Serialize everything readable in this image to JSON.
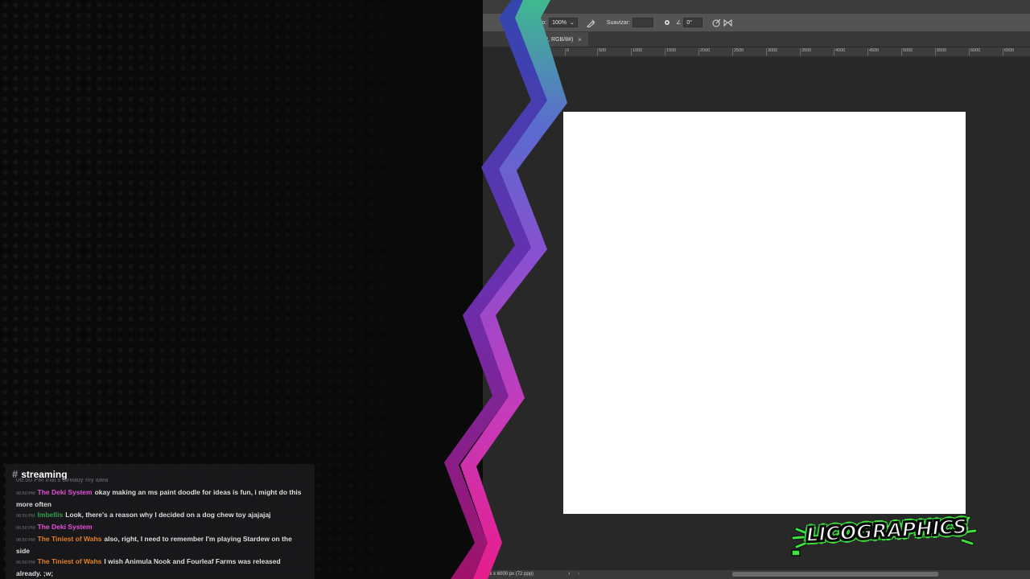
{
  "photoshop": {
    "options_bar": {
      "flow_label": "Flujo:",
      "flow_value": "100%",
      "smoothing_label": "Suavizar:",
      "smoothing_value": "",
      "angle_value": "0°"
    },
    "document_tab": {
      "label": "% (Capa 2, RGB/8#)",
      "close": "×"
    },
    "ruler_ticks": [
      "0",
      "500",
      "1000",
      "1500",
      "2000",
      "2500",
      "3000",
      "3500",
      "4000",
      "4500",
      "5000",
      "5500",
      "6000",
      "6500"
    ],
    "status_bar": {
      "document_size": "6000 px x 6000 px (72 ppp)",
      "expand_arrow": "›",
      "collapse_arrow": "‹"
    },
    "colors": {
      "workspace": "#282828",
      "options_bar": "#535353",
      "canvas": "#ffffff"
    }
  },
  "chat": {
    "hash": "#",
    "channel_name": "streaming",
    "cut_off_line": "06:50 PM  that's already my idea",
    "messages": [
      {
        "time": "06:50 PM",
        "author": "The Deki System",
        "author_color": "#e84dd9",
        "text": "okay making an ms paint doodle for ideas is fun, i might do this more often"
      },
      {
        "time": "06:50 PM",
        "author": "Imbellis",
        "author_color": "#2fa34a",
        "text": "Look, there's a reason why I decided on a dog chew toy ajajajaj"
      },
      {
        "time": "06:50 PM",
        "author": "The Deki System",
        "author_color": "#e84dd9",
        "text": ""
      },
      {
        "time": "06:50 PM",
        "author": "The Tiniest of Wahs",
        "author_color": "#e67e22",
        "text": "also, right, I need to remember I'm playing Stardew on the side"
      },
      {
        "time": "06:50 PM",
        "author": "The Tiniest of Wahs",
        "author_color": "#e67e22",
        "text": "I wish Animula Nook and Fourleaf Farms was released already. ;w;"
      }
    ]
  },
  "logo": {
    "text": "LICOGRAPHICS",
    "accent_color": "#3be23b"
  },
  "ribbon_colors": [
    "#3fb98f",
    "#5a5fd0",
    "#7d4fd0",
    "#b43fc4",
    "#e0238f"
  ]
}
